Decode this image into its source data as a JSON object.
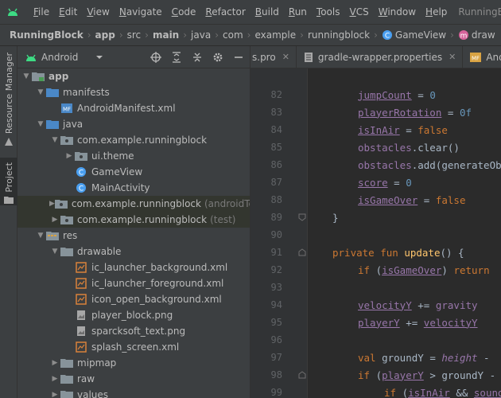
{
  "menu": {
    "items": [
      "File",
      "Edit",
      "View",
      "Navigate",
      "Code",
      "Refactor",
      "Build",
      "Run",
      "Tools",
      "VCS",
      "Window",
      "Help"
    ],
    "window_title": "RunningBlock"
  },
  "breadcrumb": [
    "RunningBlock",
    "app",
    "src",
    "main",
    "java",
    "com",
    "example",
    "runningblock",
    "GameView",
    "draw"
  ],
  "toolstrip": {
    "resource_manager": "Resource Manager",
    "project": "Project"
  },
  "project_panel": {
    "view": "Android",
    "tree": [
      {
        "label": "app",
        "dim": "",
        "icon": "module-folder-icon"
      },
      {
        "label": "manifests",
        "dim": "",
        "icon": "folder-icon"
      },
      {
        "label": "AndroidManifest.xml",
        "dim": "",
        "icon": "manifest-file-icon"
      },
      {
        "label": "java",
        "dim": "",
        "icon": "folder-icon"
      },
      {
        "label": "com.example.runningblock",
        "dim": "",
        "icon": "package-icon"
      },
      {
        "label": "ui.theme",
        "dim": "",
        "icon": "package-icon"
      },
      {
        "label": "GameView",
        "dim": "",
        "icon": "kotlin-class-icon"
      },
      {
        "label": "MainActivity",
        "dim": "",
        "icon": "kotlin-class-icon"
      },
      {
        "label": "com.example.runningblock",
        "dim": "(androidTest)",
        "icon": "package-icon"
      },
      {
        "label": "com.example.runningblock",
        "dim": "(test)",
        "icon": "package-icon"
      },
      {
        "label": "res",
        "dim": "",
        "icon": "res-folder-icon"
      },
      {
        "label": "drawable",
        "dim": "",
        "icon": "folder-icon"
      },
      {
        "label": "ic_launcher_background.xml",
        "dim": "",
        "icon": "xml-drawable-icon"
      },
      {
        "label": "ic_launcher_foreground.xml",
        "dim": "",
        "icon": "xml-drawable-icon"
      },
      {
        "label": "icon_open_background.xml",
        "dim": "",
        "icon": "xml-drawable-icon"
      },
      {
        "label": "player_block.png",
        "dim": "",
        "icon": "image-file-icon"
      },
      {
        "label": "sparcksoft_text.png",
        "dim": "",
        "icon": "image-file-icon"
      },
      {
        "label": "splash_screen.xml",
        "dim": "",
        "icon": "xml-drawable-icon"
      },
      {
        "label": "mipmap",
        "dim": "",
        "icon": "folder-icon"
      },
      {
        "label": "raw",
        "dim": "",
        "icon": "folder-icon"
      },
      {
        "label": "values",
        "dim": "",
        "icon": "folder-icon"
      }
    ]
  },
  "editor_tabs": [
    "s.pro",
    "gradle-wrapper.properties",
    "AndroidM"
  ],
  "editor": {
    "line_numbers": [
      "82",
      "83",
      "84",
      "85",
      "86",
      "87",
      "88",
      "89",
      "90",
      "91",
      "92",
      "93",
      "94",
      "95",
      "96",
      "97",
      "98",
      "99"
    ]
  },
  "colors": {
    "keyword": "#cc7832",
    "property": "#9876aa",
    "number": "#6897bb",
    "function": "#ffc66d",
    "text": "#a9b7c6",
    "kotlin_icon": "#4a9ff0"
  }
}
